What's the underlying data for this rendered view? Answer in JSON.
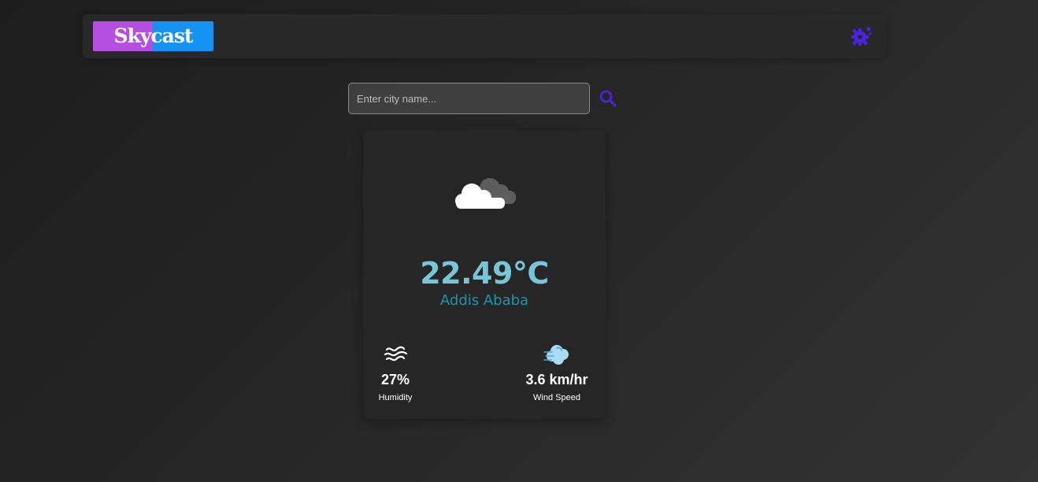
{
  "header": {
    "logo_text": "Skycast",
    "logo_colors": [
      "#b54fe2",
      "#1592f2"
    ],
    "settings_icon": "gear-sun-icon"
  },
  "search": {
    "placeholder": "Enter city name...",
    "value": "",
    "button_icon": "search-icon"
  },
  "weather": {
    "icon": "cloud-icon",
    "temperature": "22.49°C",
    "city": "Addis Ababa",
    "humidity": {
      "icon": "humidity-wave-icon",
      "value": "27%",
      "label": "Humidity"
    },
    "wind": {
      "icon": "wind-cloud-icon",
      "value": "3.6 km/hr",
      "label": "Wind Speed"
    }
  },
  "colors": {
    "accent": "#4b22e6",
    "temperature": "#78c5d8",
    "city": "#1e95ad"
  }
}
